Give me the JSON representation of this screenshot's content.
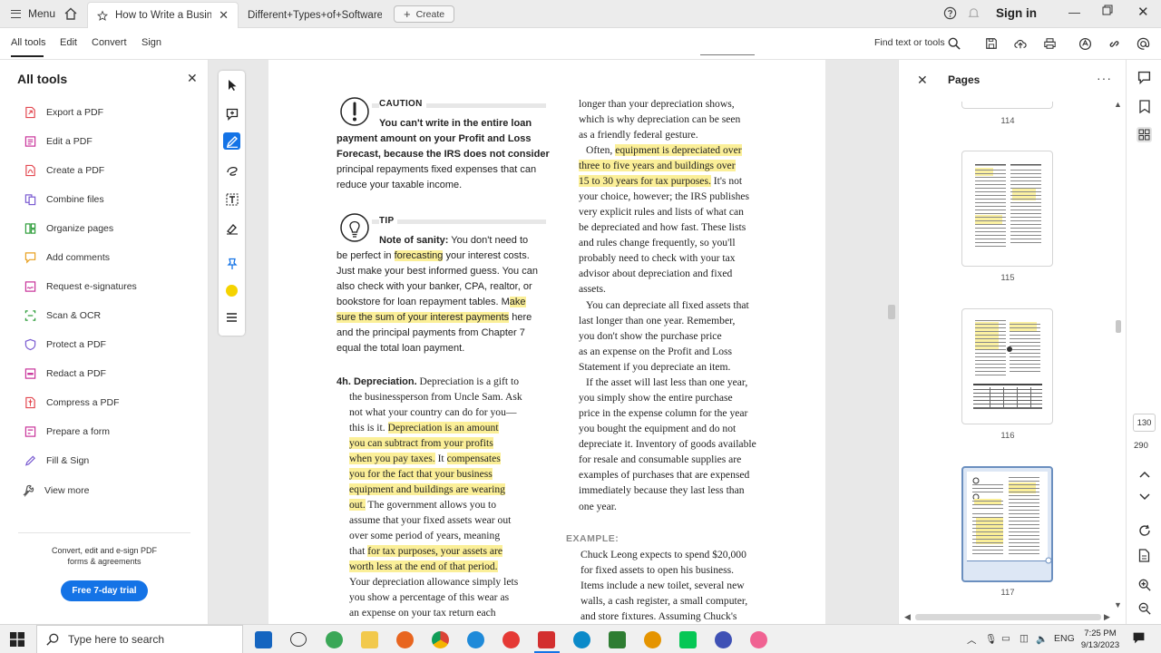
{
  "titlebar": {
    "menu_label": "Menu",
    "tabs": [
      {
        "label": "How to Write a Business ..."
      },
      {
        "label": "Different+Types+of+Software+T..."
      }
    ],
    "create_label": "Create",
    "sign_in_label": "Sign in"
  },
  "toolbar": {
    "menus": [
      "All tools",
      "Edit",
      "Convert",
      "Sign"
    ],
    "find_label": "Find text or tools"
  },
  "left_panel": {
    "title": "All tools",
    "items": [
      {
        "label": "Export a PDF",
        "icon": "export-pdf-icon",
        "color": "#e34850"
      },
      {
        "label": "Edit a PDF",
        "icon": "edit-pdf-icon",
        "color": "#c8339a"
      },
      {
        "label": "Create a PDF",
        "icon": "create-pdf-icon",
        "color": "#e34850"
      },
      {
        "label": "Combine files",
        "icon": "combine-files-icon",
        "color": "#7a5bd1"
      },
      {
        "label": "Organize pages",
        "icon": "organize-pages-icon",
        "color": "#2d9d3a"
      },
      {
        "label": "Add comments",
        "icon": "add-comments-icon",
        "color": "#e8a020"
      },
      {
        "label": "Request e-signatures",
        "icon": "request-esign-icon",
        "color": "#c8339a"
      },
      {
        "label": "Scan & OCR",
        "icon": "scan-ocr-icon",
        "color": "#2d9d3a"
      },
      {
        "label": "Protect a PDF",
        "icon": "protect-pdf-icon",
        "color": "#7a5bd1"
      },
      {
        "label": "Redact a PDF",
        "icon": "redact-pdf-icon",
        "color": "#c8339a"
      },
      {
        "label": "Compress a PDF",
        "icon": "compress-pdf-icon",
        "color": "#e34850"
      },
      {
        "label": "Prepare a form",
        "icon": "prepare-form-icon",
        "color": "#c8339a"
      },
      {
        "label": "Fill & Sign",
        "icon": "fill-sign-icon",
        "color": "#7a5bd1"
      },
      {
        "label": "View more",
        "icon": "view-more-icon",
        "color": "#555555"
      }
    ],
    "note_line1": "Convert, edit and e-sign PDF",
    "note_line2": "forms & agreements",
    "trial_button": "Free 7-day trial"
  },
  "document": {
    "caution_label": "CAUTION",
    "caution": [
      "You can't write in the entire loan",
      "payment amount on your Profit and Loss",
      "Forecast, because the IRS does not consider",
      "principal repayments fixed expenses that can",
      "reduce your taxable income."
    ],
    "tip_label": "TIP",
    "tip_lead": "Note of sanity:",
    "tip": {
      "l1": " You don't need to",
      "l2a": "be perfect in ",
      "l2b": "forecasting",
      "l2c": " your interest costs.",
      "l3": "Just make your best informed guess. You can",
      "l4": "also check with your banker, CPA, realtor, or",
      "l5a": "bookstore for loan repayment tables. M",
      "l5b": "ake",
      "l6a": "sure the sum of your interest payments",
      "l6b": " here",
      "l7": "and the principal payments from Chapter 7",
      "l8": "equal the total loan payment."
    },
    "depr": {
      "head": "4h. Depreciation.",
      "l1": " Depreciation is a gift to",
      "l2": "the businessperson from Uncle Sam. Ask",
      "l3": "not what your country can do for you—",
      "l4a": "this is it. ",
      "l4b": "Depreciation is an amount",
      "l5": "you can subtract from your profits",
      "l6a": "when you pay taxes.",
      "l6b": " It ",
      "l6c": "compensates",
      "l7": "you for the fact that your business",
      "l8": "equipment and buildings are wearing",
      "l9a": "out.",
      "l9b": " The government allows you to",
      "l10": "assume that your fixed assets wear out",
      "l11": "over some period of years, meaning",
      "l12a": "that ",
      "l12b": "for tax purposes, your assets are",
      "l13": "worth less at the end of that period.",
      "l14": "Your depreciation allowance simply lets",
      "l15": "you show a percentage of this wear as",
      "l16": "an expense on your tax return each"
    },
    "right": {
      "r1": "longer than your depreciation shows,",
      "r2": "which is why depreciation can be seen",
      "r3": "as a friendly federal gesture.",
      "r4a": "Often, ",
      "r4b": "equipment is depreciated over",
      "r5": "three to five years and buildings over",
      "r6a": "15 to 30 years for tax purposes.",
      "r6b": " It's not",
      "r7": "your choice, however; the IRS publishes",
      "r8": "very explicit rules and lists of what can",
      "r9": "be depreciated and how fast. These lists",
      "r10": "and rules change frequently, so you'll",
      "r11": "probably need to check with your tax",
      "r12": "advisor about depreciation and fixed",
      "r13": "assets.",
      "r14": "You can depreciate all fixed assets that",
      "r15": "last longer than one year. Remember,",
      "r16": "you don't show the purchase price",
      "r17": "as an expense on the Profit and Loss",
      "r18": "Statement if you depreciate an item.",
      "r19": "If the asset will last less than one year,",
      "r20": "you simply show the entire purchase",
      "r21": "price in the expense column for the year",
      "r22": "you bought the equipment and do not",
      "r23": "depreciate it. Inventory of goods available",
      "r24": "for resale and consumable supplies are",
      "r25": "examples of purchases that are expensed",
      "r26": "immediately because they last less than",
      "r27": "one year.",
      "example_label": "EXAMPLE:",
      "e1": "Chuck Leong expects to spend $20,000",
      "e2": "for fixed assets to open his business.",
      "e3": "Items include a new toilet, several new",
      "e4": "walls, a cash register, a small computer,",
      "e5": "and store fixtures. Assuming Chuck's"
    }
  },
  "pages_panel": {
    "title": "Pages",
    "page_numbers": [
      "114",
      "115",
      "116",
      "117"
    ]
  },
  "right_rail": {
    "current_page": "130",
    "total_pages": "290"
  },
  "taskbar": {
    "search_placeholder": "Type here to search",
    "language": "ENG",
    "time": "7:25 PM",
    "date": "9/13/2023"
  },
  "colors": {
    "accent": "#1473e6",
    "highlight": "#fbef98"
  }
}
